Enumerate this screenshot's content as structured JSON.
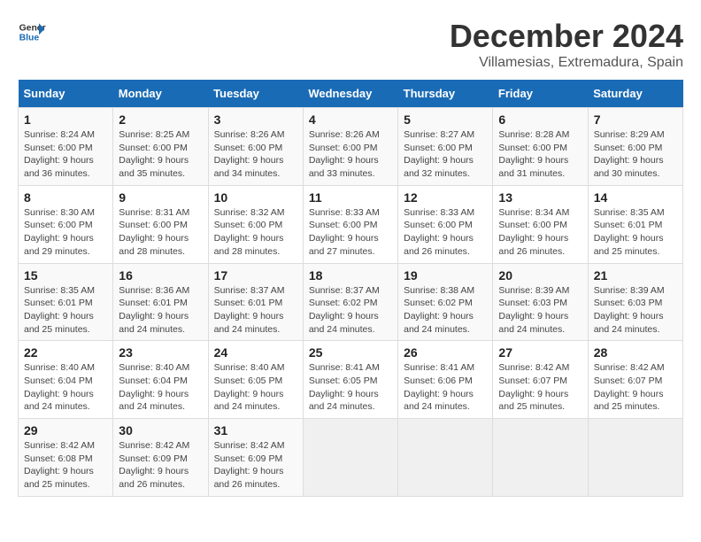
{
  "logo": {
    "text_general": "General",
    "text_blue": "Blue"
  },
  "header": {
    "title": "December 2024",
    "subtitle": "Villamesias, Extremadura, Spain"
  },
  "weekdays": [
    "Sunday",
    "Monday",
    "Tuesday",
    "Wednesday",
    "Thursday",
    "Friday",
    "Saturday"
  ],
  "weeks": [
    [
      {
        "day": "1",
        "sunrise": "8:24 AM",
        "sunset": "6:00 PM",
        "daylight": "9 hours and 36 minutes."
      },
      {
        "day": "2",
        "sunrise": "8:25 AM",
        "sunset": "6:00 PM",
        "daylight": "9 hours and 35 minutes."
      },
      {
        "day": "3",
        "sunrise": "8:26 AM",
        "sunset": "6:00 PM",
        "daylight": "9 hours and 34 minutes."
      },
      {
        "day": "4",
        "sunrise": "8:26 AM",
        "sunset": "6:00 PM",
        "daylight": "9 hours and 33 minutes."
      },
      {
        "day": "5",
        "sunrise": "8:27 AM",
        "sunset": "6:00 PM",
        "daylight": "9 hours and 32 minutes."
      },
      {
        "day": "6",
        "sunrise": "8:28 AM",
        "sunset": "6:00 PM",
        "daylight": "9 hours and 31 minutes."
      },
      {
        "day": "7",
        "sunrise": "8:29 AM",
        "sunset": "6:00 PM",
        "daylight": "9 hours and 30 minutes."
      }
    ],
    [
      {
        "day": "8",
        "sunrise": "8:30 AM",
        "sunset": "6:00 PM",
        "daylight": "9 hours and 29 minutes."
      },
      {
        "day": "9",
        "sunrise": "8:31 AM",
        "sunset": "6:00 PM",
        "daylight": "9 hours and 28 minutes."
      },
      {
        "day": "10",
        "sunrise": "8:32 AM",
        "sunset": "6:00 PM",
        "daylight": "9 hours and 28 minutes."
      },
      {
        "day": "11",
        "sunrise": "8:33 AM",
        "sunset": "6:00 PM",
        "daylight": "9 hours and 27 minutes."
      },
      {
        "day": "12",
        "sunrise": "8:33 AM",
        "sunset": "6:00 PM",
        "daylight": "9 hours and 26 minutes."
      },
      {
        "day": "13",
        "sunrise": "8:34 AM",
        "sunset": "6:00 PM",
        "daylight": "9 hours and 26 minutes."
      },
      {
        "day": "14",
        "sunrise": "8:35 AM",
        "sunset": "6:01 PM",
        "daylight": "9 hours and 25 minutes."
      }
    ],
    [
      {
        "day": "15",
        "sunrise": "8:35 AM",
        "sunset": "6:01 PM",
        "daylight": "9 hours and 25 minutes."
      },
      {
        "day": "16",
        "sunrise": "8:36 AM",
        "sunset": "6:01 PM",
        "daylight": "9 hours and 24 minutes."
      },
      {
        "day": "17",
        "sunrise": "8:37 AM",
        "sunset": "6:01 PM",
        "daylight": "9 hours and 24 minutes."
      },
      {
        "day": "18",
        "sunrise": "8:37 AM",
        "sunset": "6:02 PM",
        "daylight": "9 hours and 24 minutes."
      },
      {
        "day": "19",
        "sunrise": "8:38 AM",
        "sunset": "6:02 PM",
        "daylight": "9 hours and 24 minutes."
      },
      {
        "day": "20",
        "sunrise": "8:39 AM",
        "sunset": "6:03 PM",
        "daylight": "9 hours and 24 minutes."
      },
      {
        "day": "21",
        "sunrise": "8:39 AM",
        "sunset": "6:03 PM",
        "daylight": "9 hours and 24 minutes."
      }
    ],
    [
      {
        "day": "22",
        "sunrise": "8:40 AM",
        "sunset": "6:04 PM",
        "daylight": "9 hours and 24 minutes."
      },
      {
        "day": "23",
        "sunrise": "8:40 AM",
        "sunset": "6:04 PM",
        "daylight": "9 hours and 24 minutes."
      },
      {
        "day": "24",
        "sunrise": "8:40 AM",
        "sunset": "6:05 PM",
        "daylight": "9 hours and 24 minutes."
      },
      {
        "day": "25",
        "sunrise": "8:41 AM",
        "sunset": "6:05 PM",
        "daylight": "9 hours and 24 minutes."
      },
      {
        "day": "26",
        "sunrise": "8:41 AM",
        "sunset": "6:06 PM",
        "daylight": "9 hours and 24 minutes."
      },
      {
        "day": "27",
        "sunrise": "8:42 AM",
        "sunset": "6:07 PM",
        "daylight": "9 hours and 25 minutes."
      },
      {
        "day": "28",
        "sunrise": "8:42 AM",
        "sunset": "6:07 PM",
        "daylight": "9 hours and 25 minutes."
      }
    ],
    [
      {
        "day": "29",
        "sunrise": "8:42 AM",
        "sunset": "6:08 PM",
        "daylight": "9 hours and 25 minutes."
      },
      {
        "day": "30",
        "sunrise": "8:42 AM",
        "sunset": "6:09 PM",
        "daylight": "9 hours and 26 minutes."
      },
      {
        "day": "31",
        "sunrise": "8:42 AM",
        "sunset": "6:09 PM",
        "daylight": "9 hours and 26 minutes."
      },
      null,
      null,
      null,
      null
    ]
  ],
  "labels": {
    "sunrise": "Sunrise:",
    "sunset": "Sunset:",
    "daylight": "Daylight:"
  }
}
